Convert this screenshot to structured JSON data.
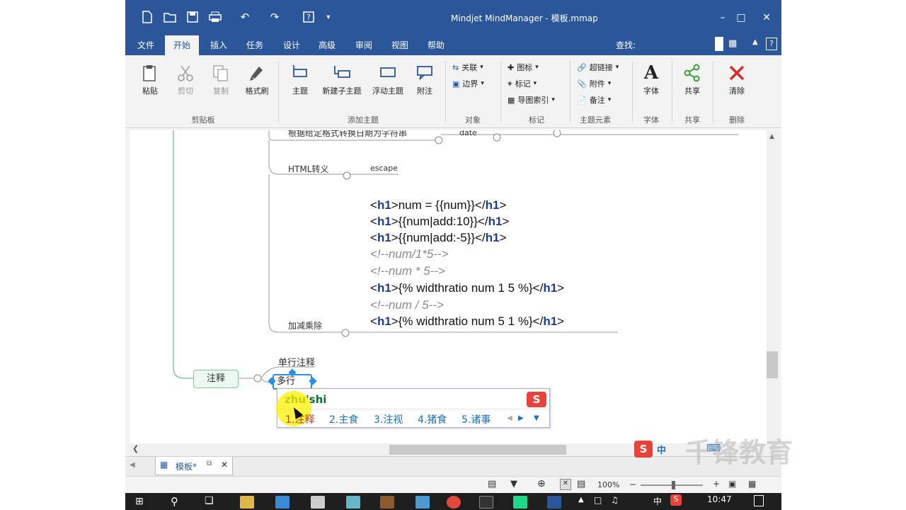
{
  "window": {
    "title": "Mindjet MindManager - 模板.mmap",
    "minimize": "–",
    "maximize": "□",
    "close": "✕"
  },
  "tabs": [
    "文件",
    "开始",
    "插入",
    "任务",
    "设计",
    "高级",
    "审阅",
    "视图",
    "帮助"
  ],
  "search_label": "查找:",
  "ribbon": {
    "paste": "粘贴",
    "cut": "剪切",
    "copy": "复制",
    "format_painter": "格式刷",
    "clipboard_group": "剪贴板",
    "topic": "主题",
    "new_subtopic": "新建子主题",
    "floating_topic": "浮动主题",
    "callout": "附注",
    "add_topic_group": "添加主题",
    "relationship": "关联",
    "boundary": "边界",
    "object_group": "对象",
    "icon": "图标",
    "tag": "标记",
    "map_index": "导图索引",
    "marker_group": "标记",
    "hyperlink": "超链接",
    "attachment": "附件",
    "notes": "备注",
    "elements_group": "主题元素",
    "font": "字体",
    "font_group": "字体",
    "share": "共享",
    "share_group": "共享",
    "clear": "清除",
    "delete_group": "删除"
  },
  "map": {
    "date_node_partial": "根据给定格式转换日期为字符串",
    "date_tag": "date",
    "html_escape": "HTML转义",
    "escape_tag": "escape",
    "code_lines": [
      {
        "kind": "tag",
        "pre": "<",
        "tag": "h1",
        "mid": ">num = {{num}}</",
        "tag2": "h1",
        "post": ">"
      },
      {
        "kind": "tag",
        "pre": "<",
        "tag": "h1",
        "mid": ">{{num|add:10}}</",
        "tag2": "h1",
        "post": ">"
      },
      {
        "kind": "tag",
        "pre": "<",
        "tag": "h1",
        "mid": ">{{num|add:-5}}</",
        "tag2": "h1",
        "post": ">"
      },
      {
        "kind": "comment",
        "text": "<!--num/1*5-->"
      },
      {
        "kind": "comment",
        "text": "<!--num * 5-->"
      },
      {
        "kind": "tag",
        "pre": "<",
        "tag": "h1",
        "mid": ">{% widthratio num 1 5 %}</",
        "tag2": "h1",
        "post": ">"
      },
      {
        "kind": "comment",
        "text": "<!--num / 5-->"
      },
      {
        "kind": "tag",
        "pre": "<",
        "tag": "h1",
        "mid": ">{% widthratio num 5 1 %}</",
        "tag2": "h1",
        "post": ">"
      }
    ],
    "arith_node": "加减乘除",
    "comment_node": "注释",
    "single_line_comment": "单行注释",
    "multi_line_editing": "多行"
  },
  "ime": {
    "input": "zhu'shi",
    "candidates": [
      "1.注释",
      "2.主食",
      "3.注视",
      "4.猪食",
      "5.诸事"
    ]
  },
  "doc_tab": {
    "label": "模板*"
  },
  "status": {
    "zoom": "100%"
  },
  "taskbar": {
    "clock": "10:47",
    "lang": "中"
  },
  "watermark": "千锋教育",
  "tray_ime": "中"
}
